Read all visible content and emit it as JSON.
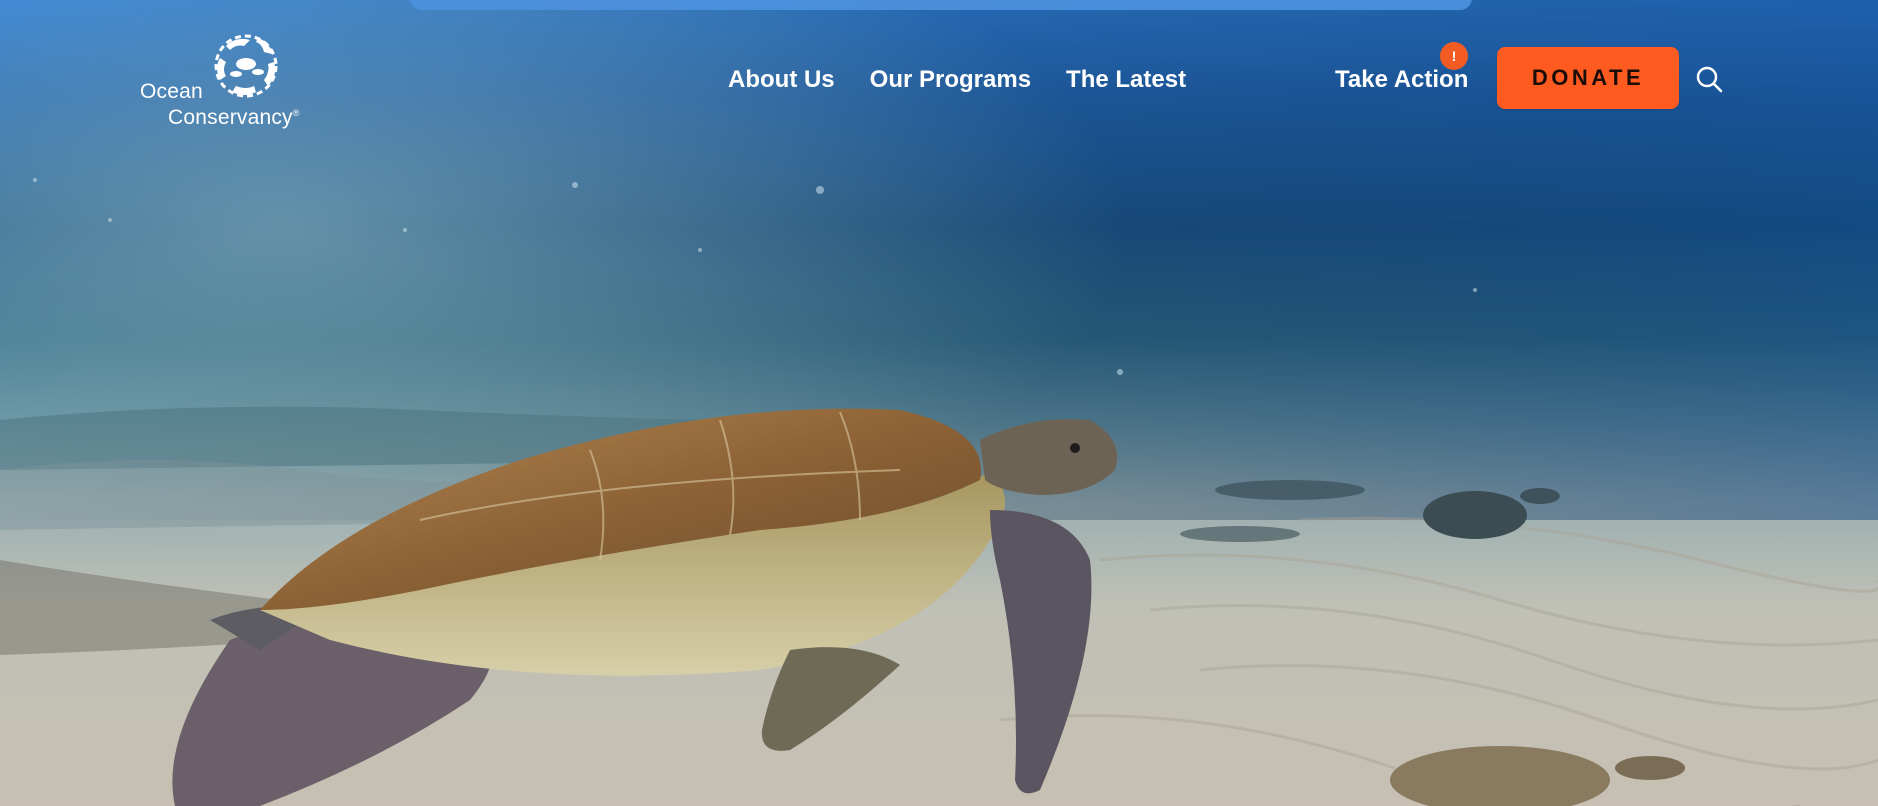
{
  "brand": {
    "name_line1": "Ocean",
    "name_line2": "Conservancy",
    "registered_mark": "®",
    "logo_icon": "fish-circle-logo"
  },
  "nav": {
    "items": [
      {
        "label": "About Us"
      },
      {
        "label": "Our Programs"
      },
      {
        "label": "The Latest"
      }
    ],
    "take_action": {
      "label": "Take Action",
      "badge": "!"
    },
    "donate": {
      "label": "DONATE"
    },
    "search": {
      "icon": "search-icon"
    }
  },
  "hero": {
    "scene": "sea turtle swimming over sandy ocean floor"
  },
  "colors": {
    "donate_bg": "#ff5a1f",
    "badge_bg": "#f25c22",
    "nav_text": "#ffffff",
    "banner": "#4c90dc"
  }
}
